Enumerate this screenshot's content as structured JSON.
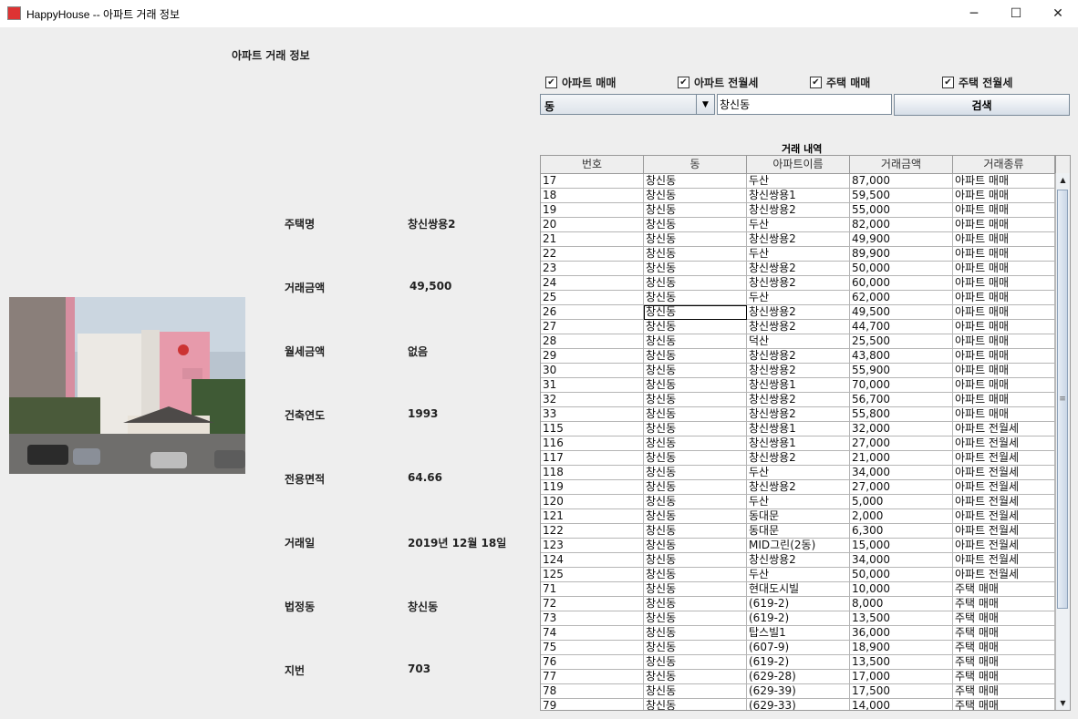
{
  "window": {
    "title": "HappyHouse -- 아파트 거래 정보",
    "minimize": "─",
    "maximize": "☐",
    "close": "✕"
  },
  "heading": "아파트 거래 정보",
  "details": [
    {
      "label": "주택명",
      "value": "창신쌍용2"
    },
    {
      "label": "거래금액",
      "value": "49,500"
    },
    {
      "label": "월세금액",
      "value": "없음"
    },
    {
      "label": "건축연도",
      "value": "1993"
    },
    {
      "label": "전용면적",
      "value": "64.66"
    },
    {
      "label": "거래일",
      "value": "2019년 12월 18일"
    },
    {
      "label": "법정동",
      "value": "창신동"
    },
    {
      "label": "지번",
      "value": "703"
    }
  ],
  "filters": [
    {
      "label": "아파트 매매",
      "checked": true
    },
    {
      "label": "아파트 전월세",
      "checked": true
    },
    {
      "label": "주택 매매",
      "checked": true
    },
    {
      "label": "주택 전월세",
      "checked": true
    }
  ],
  "search": {
    "combo_value": "동",
    "input_value": "창신동",
    "button_label": "검색"
  },
  "table": {
    "caption": "거래 내역",
    "columns": [
      "번호",
      "동",
      "아파트이름",
      "거래금액",
      "거래종류"
    ],
    "rows": [
      [
        "17",
        "창신동",
        "두산",
        "87,000",
        "아파트 매매"
      ],
      [
        "18",
        "창신동",
        "창신쌍용1",
        "59,500",
        "아파트 매매"
      ],
      [
        "19",
        "창신동",
        "창신쌍용2",
        "55,000",
        "아파트 매매"
      ],
      [
        "20",
        "창신동",
        "두산",
        "82,000",
        "아파트 매매"
      ],
      [
        "21",
        "창신동",
        "창신쌍용2",
        "49,900",
        "아파트 매매"
      ],
      [
        "22",
        "창신동",
        "두산",
        "89,900",
        "아파트 매매"
      ],
      [
        "23",
        "창신동",
        "창신쌍용2",
        "50,000",
        "아파트 매매"
      ],
      [
        "24",
        "창신동",
        "창신쌍용2",
        "60,000",
        "아파트 매매"
      ],
      [
        "25",
        "창신동",
        "두산",
        "62,000",
        "아파트 매매"
      ],
      [
        "26",
        "창신동",
        "창신쌍용2",
        "49,500",
        "아파트 매매"
      ],
      [
        "27",
        "창신동",
        "창신쌍용2",
        "44,700",
        "아파트 매매"
      ],
      [
        "28",
        "창신동",
        "덕산",
        "25,500",
        "아파트 매매"
      ],
      [
        "29",
        "창신동",
        "창신쌍용2",
        "43,800",
        "아파트 매매"
      ],
      [
        "30",
        "창신동",
        "창신쌍용2",
        "55,900",
        "아파트 매매"
      ],
      [
        "31",
        "창신동",
        "창신쌍용1",
        "70,000",
        "아파트 매매"
      ],
      [
        "32",
        "창신동",
        "창신쌍용2",
        "56,700",
        "아파트 매매"
      ],
      [
        "33",
        "창신동",
        "창신쌍용2",
        "55,800",
        "아파트 매매"
      ],
      [
        "115",
        "창신동",
        "창신쌍용1",
        "32,000",
        "아파트 전월세"
      ],
      [
        "116",
        "창신동",
        "창신쌍용1",
        "27,000",
        "아파트 전월세"
      ],
      [
        "117",
        "창신동",
        "창신쌍용2",
        "21,000",
        "아파트 전월세"
      ],
      [
        "118",
        "창신동",
        "두산",
        "34,000",
        "아파트 전월세"
      ],
      [
        "119",
        "창신동",
        "창신쌍용2",
        "27,000",
        "아파트 전월세"
      ],
      [
        "120",
        "창신동",
        "두산",
        "5,000",
        "아파트 전월세"
      ],
      [
        "121",
        "창신동",
        "동대문",
        "2,000",
        "아파트 전월세"
      ],
      [
        "122",
        "창신동",
        "동대문",
        "6,300",
        "아파트 전월세"
      ],
      [
        "123",
        "창신동",
        "MID그린(2동)",
        "15,000",
        "아파트 전월세"
      ],
      [
        "124",
        "창신동",
        "창신쌍용2",
        "34,000",
        "아파트 전월세"
      ],
      [
        "125",
        "창신동",
        "두산",
        "50,000",
        "아파트 전월세"
      ],
      [
        "71",
        "창신동",
        "현대도시빌",
        "10,000",
        "주택 매매"
      ],
      [
        "72",
        "창신동",
        "(619-2)",
        "8,000",
        "주택 매매"
      ],
      [
        "73",
        "창신동",
        "(619-2)",
        "13,500",
        "주택 매매"
      ],
      [
        "74",
        "창신동",
        "탑스빌1",
        "36,000",
        "주택 매매"
      ],
      [
        "75",
        "창신동",
        "(607-9)",
        "18,900",
        "주택 매매"
      ],
      [
        "76",
        "창신동",
        "(619-2)",
        "13,500",
        "주택 매매"
      ],
      [
        "77",
        "창신동",
        "(629-28)",
        "17,000",
        "주택 매매"
      ],
      [
        "78",
        "창신동",
        "(629-39)",
        "17,500",
        "주택 매매"
      ],
      [
        "79",
        "창신동",
        "(629-33)",
        "14,000",
        "주택 매매"
      ]
    ],
    "selected_row": 9,
    "selected_col": 1
  },
  "scrollbar": {
    "up": "▲",
    "down": "▼",
    "grip": "≡"
  },
  "icons": {
    "app": "app-icon",
    "check": "✔",
    "combo_arrow": "▼"
  }
}
